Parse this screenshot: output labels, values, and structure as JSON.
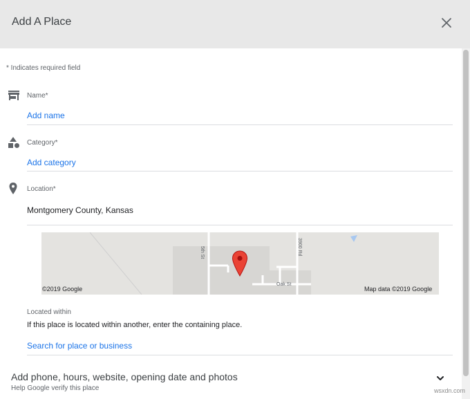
{
  "header": {
    "title": "Add A Place",
    "close_icon": "close-icon"
  },
  "required_note": "* Indicates required field",
  "fields": {
    "name": {
      "icon": "store-icon",
      "label": "Name*",
      "placeholder": "Add name"
    },
    "category": {
      "icon": "shapes-icon",
      "label": "Category*",
      "placeholder": "Add category"
    },
    "location": {
      "icon": "location-pin-icon",
      "label": "Location*",
      "value": "Montgomery County, Kansas"
    }
  },
  "map": {
    "copyright_left": "©2019 Google",
    "copyright_right": "Map data ©2019 Google",
    "roads": [
      "5th St",
      "3900 Rd",
      "Oak St"
    ],
    "marker_color": "#ea4335"
  },
  "located_within": {
    "label": "Located within",
    "help": "If this place is located within another, enter the containing place.",
    "placeholder": "Search for place or business"
  },
  "more_details": {
    "title": "Add phone, hours, website, opening date and photos",
    "subtitle": "Help Google verify this place",
    "chevron": "chevron-down-icon"
  },
  "watermark": "wsxdn.com",
  "colors": {
    "link": "#1a73e8",
    "header_bg": "#e8e8e8",
    "icon": "#5f6368"
  }
}
